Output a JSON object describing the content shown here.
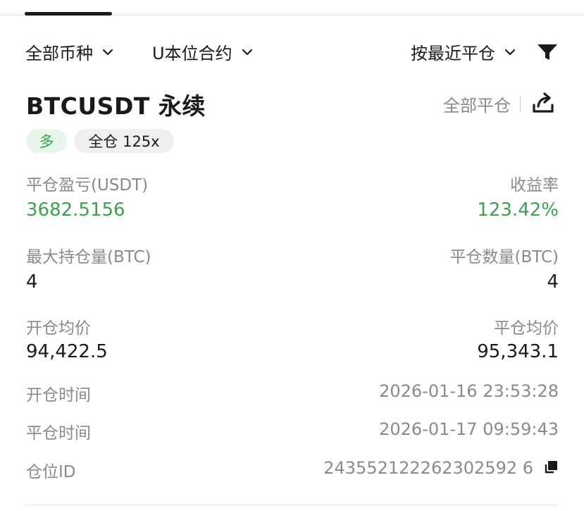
{
  "filters": {
    "currency": "全部币种",
    "contract_type": "U本位合约",
    "sort": "按最近平仓"
  },
  "position": {
    "title": "BTCUSDT 永续",
    "close_all": "全部平仓",
    "side": "多",
    "margin": "全仓 125x",
    "pnl_label": "平仓盈亏(USDT)",
    "pnl_value": "3682.5156",
    "roi_label": "收益率",
    "roi_value": "123.42%",
    "max_pos_label": "最大持仓量(BTC)",
    "max_pos_value": "4",
    "close_qty_label": "平仓数量(BTC)",
    "close_qty_value": "4",
    "open_avg_label": "开仓均价",
    "open_avg_value": "94,422.5",
    "close_avg_label": "平仓均价",
    "close_avg_value": "95,343.1",
    "open_time_label": "开仓时间",
    "open_time_value": "2026-01-16 23:53:28",
    "close_time_label": "平仓时间",
    "close_time_value": "2026-01-17 09:59:43",
    "id_label": "仓位ID",
    "id_value": "243552122262302592 6"
  },
  "colors": {
    "profit": "#3aa34d",
    "muted": "#8a8a8a",
    "text": "#1a1a1a"
  },
  "icons": {
    "filter": "funnel-icon",
    "share": "share-icon",
    "copy": "copy-icon",
    "dropdown": "chevron-down-icon"
  }
}
